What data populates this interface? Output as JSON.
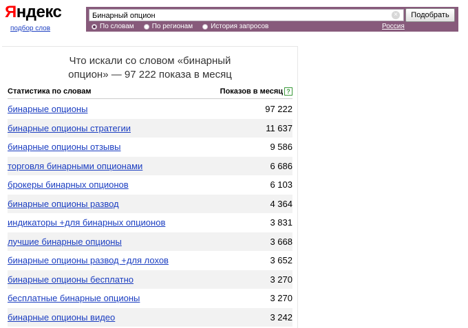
{
  "header": {
    "logo_first": "Я",
    "logo_rest": "ндекс",
    "wordstat_link": "подбор слов",
    "search_value": "Бинарный опцион",
    "submit_label": "Подобрать",
    "modes": [
      {
        "label": "По словам",
        "checked": true
      },
      {
        "label": "По регионам",
        "checked": false
      },
      {
        "label": "История запросов",
        "checked": false
      }
    ],
    "region": "Россия",
    "accent_color": "#875a7b"
  },
  "results": {
    "title_line1": "Что искали со словом «бинарный",
    "title_line2": "опцион» — 97 222 показа в месяц",
    "col_query": "Статистика по словам",
    "col_count": "Показов в месяц",
    "help_glyph": "?",
    "rows": [
      {
        "phrase": "бинарные опционы",
        "count": "97 222"
      },
      {
        "phrase": "бинарные опционы стратегии",
        "count": "11 637"
      },
      {
        "phrase": "бинарные опционы отзывы",
        "count": "9 586"
      },
      {
        "phrase": "торговля бинарными опционами",
        "count": "6 686"
      },
      {
        "phrase": "брокеры бинарных опционов",
        "count": "6 103"
      },
      {
        "phrase": "бинарные опционы развод",
        "count": "4 364"
      },
      {
        "phrase": "индикаторы +для бинарных опционов",
        "count": "3 831"
      },
      {
        "phrase": "лучшие бинарные опционы",
        "count": "3 668"
      },
      {
        "phrase": "бинарные опционы развод +для лохов",
        "count": "3 652"
      },
      {
        "phrase": "бинарные опционы бесплатно",
        "count": "3 270"
      },
      {
        "phrase": "бесплатные бинарные опционы",
        "count": "3 270"
      },
      {
        "phrase": "бинарные опционы видео",
        "count": "3 242"
      }
    ]
  }
}
